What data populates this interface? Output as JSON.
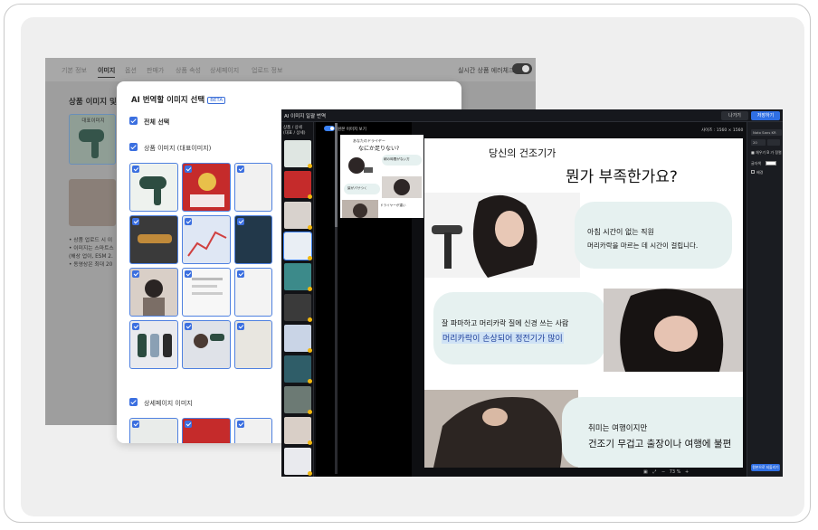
{
  "background_window": {
    "tabs": [
      "기본 정보",
      "이미지",
      "옵션",
      "판매가",
      "상품 속성",
      "상세페이지",
      "업로드 정보"
    ],
    "active_tab": "이미지",
    "realtime_label": "실시간 상품 에러체크",
    "section_title": "상품 이미지 및",
    "rep_label": "대표이미지",
    "notes": [
      "• 상품 업로드 시 이",
      "• 이미지는 스마트스",
      "(해상 업이, ESM 2.",
      "• 동영상은 최대 20"
    ]
  },
  "modal": {
    "title": "AI 번역할 이미지 선택",
    "beta": "BETA",
    "select_all": "전체 선택",
    "product_images_label": "상품 이미지 (대표이미지)",
    "detail_images_label": "상세페이지 이미지"
  },
  "app": {
    "title": "AI 이미지 일괄 번역",
    "prev_button": "나가기",
    "save_button": "저장하기",
    "thumb_label_1": "상품 / 상세",
    "thumb_label_2": "(대표 / 상세)",
    "toggle_label": "원본 이미지 보기",
    "size_label": "사이즈 : 1560 × 1560",
    "right_panel": {
      "font_select": "Noto Sans KR",
      "size_value": "20",
      "tools": "■ 채우기  B  가  정렬",
      "stroke_label": "글자색",
      "bg_label": "배경",
      "apply_button": "원본으로 되돌리기"
    },
    "zoom": "73 %",
    "preview": {
      "line1": "あなたのドライヤー",
      "line2": "なにか足りない?",
      "line3": "朝の時間がない方",
      "line4": "髪がパサつく",
      "line5": "ドライヤーが重い"
    },
    "canvas": {
      "headline_small": "당신의 건조기가",
      "headline_big": "뭔가 부족한가요?",
      "b1_line1": "아침 시간이 없는 직원",
      "b1_line2": "머리카락을 마르는 데 시간이 걸립니다.",
      "b2_line1": "잘 파마하고 머리카락 질에 신경 쓰는 사람",
      "b2_line2": "머리카락이 손상되어 정전기가 많이",
      "b3_line1": "취미는 여행이지만",
      "b3_line2": "건조기 무겁고 출장이나 여행에 불편"
    }
  },
  "colors": {
    "accent": "#3b6fe0",
    "app_bg": "#0e0f12",
    "bubble": "#e6f1f0",
    "highlight": "#cfe2f5"
  }
}
